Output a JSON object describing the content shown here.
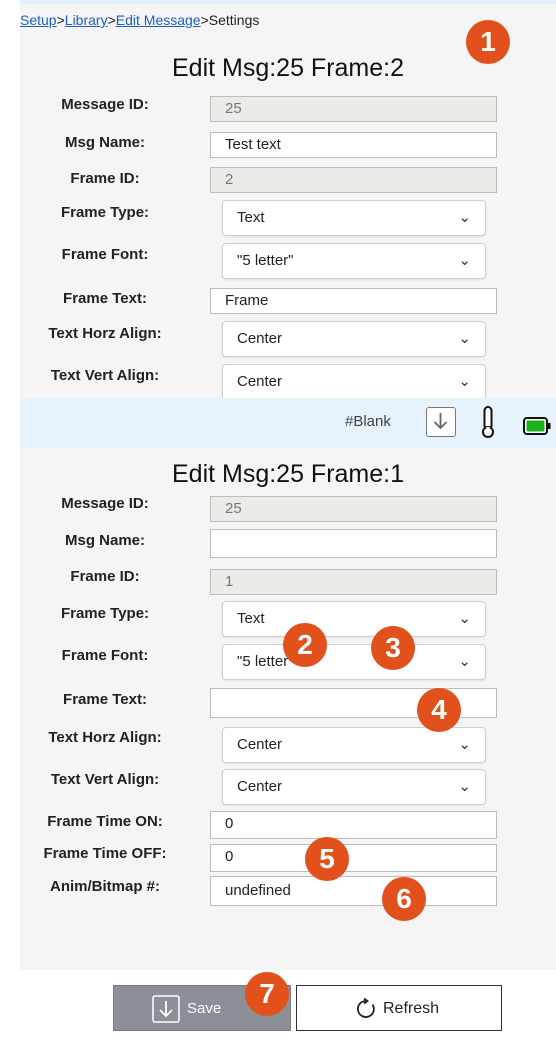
{
  "breadcrumb": {
    "items": [
      {
        "label": "Setup",
        "link": true
      },
      {
        "label": "Library",
        "link": true
      },
      {
        "label": "Edit Message",
        "link": true
      },
      {
        "label": "Settings",
        "link": false
      }
    ],
    "separator": ">"
  },
  "panel1": {
    "title": "Edit Msg:25 Frame:2",
    "fields": {
      "message_id": {
        "label": "Message ID:",
        "value": "25"
      },
      "msg_name": {
        "label": "Msg Name:",
        "value": "Test text"
      },
      "frame_id": {
        "label": "Frame ID:",
        "value": "2"
      },
      "frame_type": {
        "label": "Frame Type:",
        "value": "Text"
      },
      "frame_font": {
        "label": "Frame Font:",
        "value": "\"5 letter\""
      },
      "frame_text": {
        "label": "Frame Text:",
        "value": "Frame"
      },
      "text_horz_align": {
        "label": "Text Horz Align:",
        "value": "Center"
      },
      "text_vert_align": {
        "label": "Text Vert Align:",
        "value": "Center"
      }
    }
  },
  "statusbar": {
    "text": "#Blank",
    "icons": [
      "download-icon",
      "thermometer-icon",
      "battery-icon"
    ],
    "battery_color": "#1bb31b"
  },
  "panel2": {
    "title": "Edit Msg:25 Frame:1",
    "fields": {
      "message_id": {
        "label": "Message ID:",
        "value": "25"
      },
      "msg_name": {
        "label": "Msg Name:",
        "value": ""
      },
      "frame_id": {
        "label": "Frame ID:",
        "value": "1"
      },
      "frame_type": {
        "label": "Frame Type:",
        "value": "Text"
      },
      "frame_font": {
        "label": "Frame Font:",
        "value": "\"5 letter\""
      },
      "frame_text": {
        "label": "Frame Text:",
        "value": ""
      },
      "text_horz_align": {
        "label": "Text Horz Align:",
        "value": "Center"
      },
      "text_vert_align": {
        "label": "Text Vert Align:",
        "value": "Center"
      },
      "frame_time_on": {
        "label": "Frame Time ON:",
        "value": "0"
      },
      "frame_time_off": {
        "label": "Frame Time OFF:",
        "value": "0"
      },
      "anim_bitmap": {
        "label": "Anim/Bitmap #:",
        "value": "undefined"
      }
    }
  },
  "badges": [
    "1",
    "2",
    "3",
    "4",
    "5",
    "6",
    "7"
  ],
  "badge_color": "#e2511b",
  "actions": {
    "save_label": "Save",
    "refresh_label": "Refresh"
  }
}
